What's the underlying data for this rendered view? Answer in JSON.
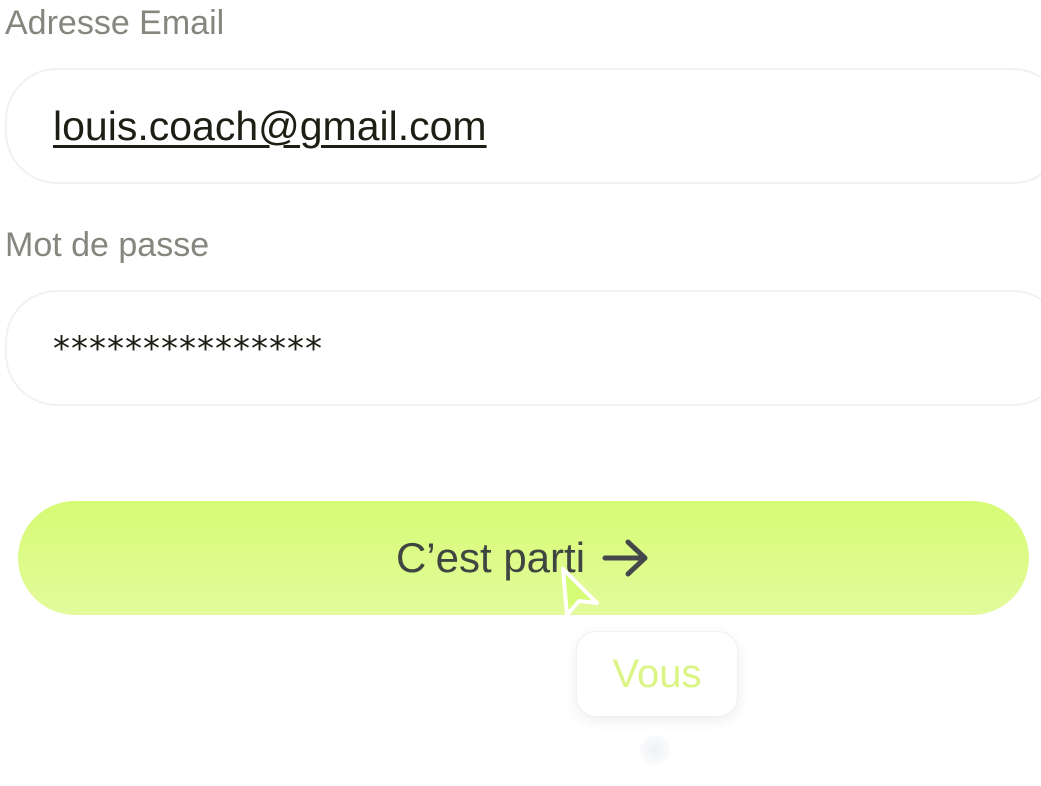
{
  "form": {
    "email": {
      "label": "Adresse Email",
      "value": "louis.coach@gmail.com"
    },
    "password": {
      "label": "Mot de passe",
      "value": "***************"
    },
    "submit": {
      "label": "C’est parti",
      "icon": "arrow-right-icon"
    }
  },
  "cursor": {
    "icon": "mouse-pointer-icon",
    "tooltip_label": "Vous"
  },
  "colors": {
    "accent": "#d6fb74",
    "label_gray": "#86867e",
    "text_dark": "#1e1e14",
    "tooltip_text": "#dbf584"
  }
}
